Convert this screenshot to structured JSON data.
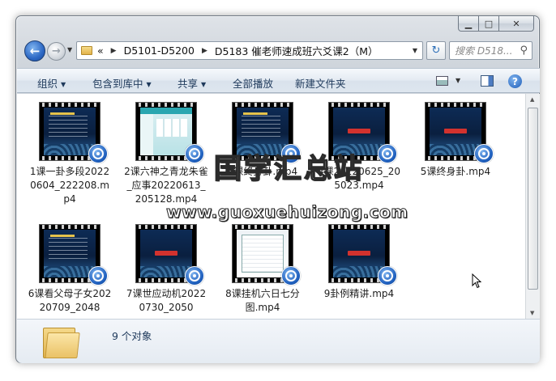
{
  "window": {
    "title": ""
  },
  "address": {
    "overflow": "«",
    "crumbs": [
      "D5101-D5200",
      "D5183 催老师速成班六爻课2（M）"
    ]
  },
  "search": {
    "placeholder": "搜索 D518..."
  },
  "toolbar": {
    "organize": "组织",
    "include_library": "包含到库中",
    "share": "共享",
    "play_all": "全部播放",
    "new_folder": "新建文件夹"
  },
  "files": [
    {
      "name": "1课一卦多段20220604_222208.mp4",
      "thumb": "slide"
    },
    {
      "name": "2课六神之青龙朱雀_应事20220613_205128.mp4",
      "thumb": "app"
    },
    {
      "name": "3课终身卦.mp4",
      "thumb": "slide"
    },
    {
      "name": "4课20220625_205023.mp4",
      "thumb": "title"
    },
    {
      "name": "5课终身卦.mp4",
      "thumb": "title"
    },
    {
      "name": "6课看父母子女20220709_2048",
      "thumb": "slide"
    },
    {
      "name": "7课世应动机20220730_2050",
      "thumb": "title"
    },
    {
      "name": "8课挂机六日七分图.mp4",
      "thumb": "light"
    },
    {
      "name": "9卦例精讲.mp4",
      "thumb": "title"
    }
  ],
  "watermark": {
    "cn": "国学汇总站",
    "url": "www.guoxuehuizong.com"
  },
  "status": {
    "count": "9 个对象"
  },
  "icons": {
    "back": "back-arrow-icon",
    "forward": "forward-arrow-icon",
    "refresh": "refresh-icon",
    "search": "magnifier-icon",
    "help": "help-icon"
  }
}
